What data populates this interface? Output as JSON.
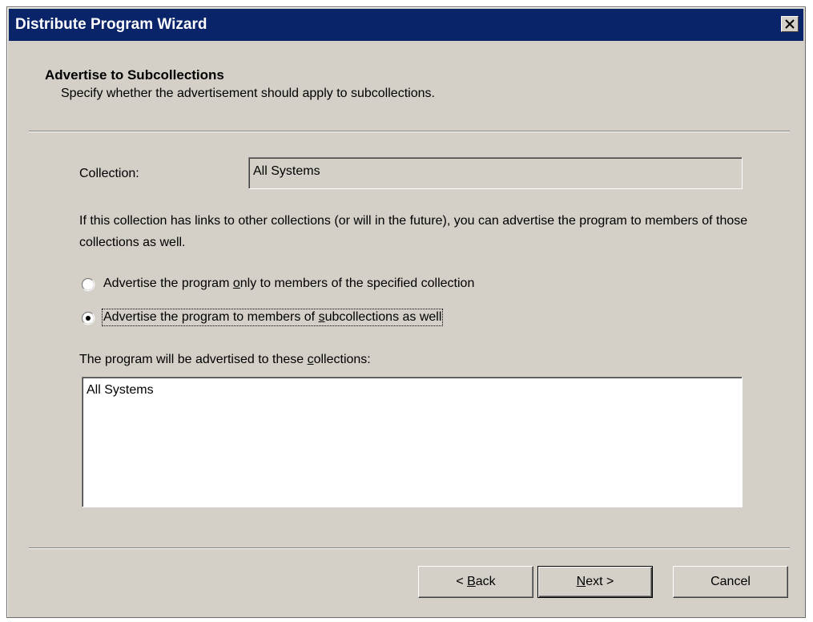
{
  "window": {
    "title": "Distribute Program Wizard",
    "close_icon": "close-icon"
  },
  "header": {
    "title": "Advertise to Subcollections",
    "subtitle": "Specify whether the advertisement should apply to subcollections."
  },
  "form": {
    "collection_label": "Collection:",
    "collection_value": "All Systems",
    "description": "If this collection has links to other collections (or will in the future), you can advertise the program to members of those collections as well.",
    "radio_options": [
      {
        "before": "Advertise the program ",
        "mnemonic": "o",
        "after": "nly to members of the specified collection",
        "checked": false
      },
      {
        "before": "Advertise the program to members of ",
        "mnemonic": "s",
        "after": "ubcollections as well",
        "checked": true
      }
    ],
    "list_label_before": "The program will be advertised to these ",
    "list_label_mnemonic": "c",
    "list_label_after": "ollections:",
    "list_items": [
      "All Systems"
    ]
  },
  "buttons": {
    "back": {
      "prefix": "< ",
      "mnemonic": "B",
      "rest": "ack"
    },
    "next": {
      "prefix": "",
      "mnemonic": "N",
      "rest": "ext >"
    },
    "cancel": "Cancel"
  },
  "colors": {
    "title_bar": "#0a246a",
    "window_bg": "#d4d0c8"
  }
}
